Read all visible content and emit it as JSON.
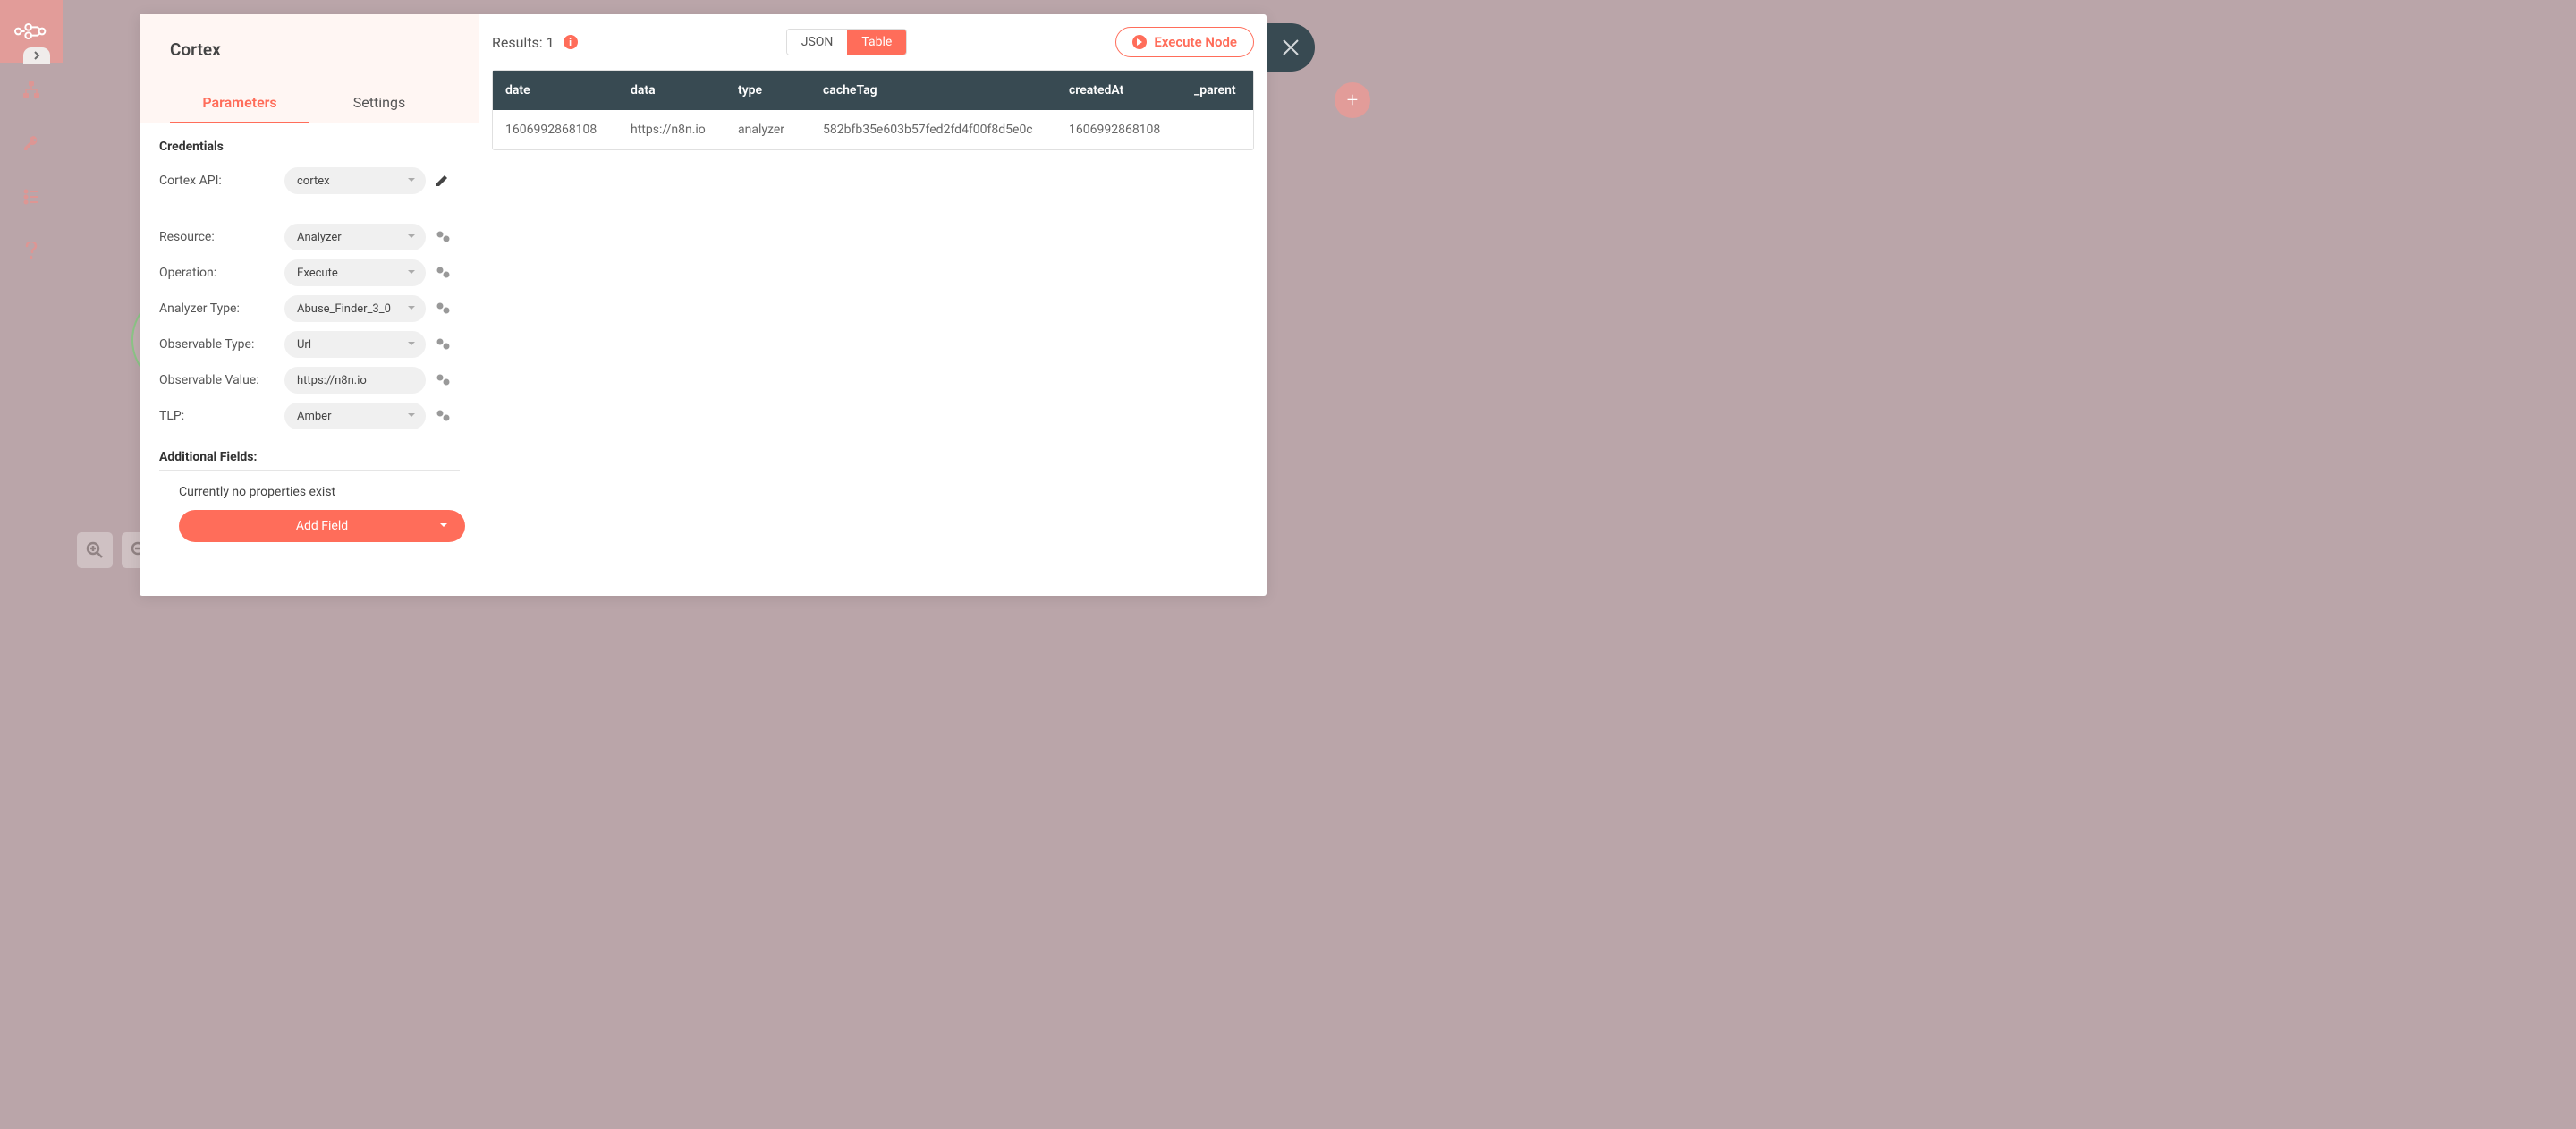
{
  "node": {
    "title": "Cortex",
    "tabs": {
      "parameters": "Parameters",
      "settings": "Settings"
    }
  },
  "credentials": {
    "section": "Credentials",
    "api_label": "Cortex API:",
    "api_value": "cortex"
  },
  "params": {
    "resource": {
      "label": "Resource:",
      "value": "Analyzer"
    },
    "operation": {
      "label": "Operation:",
      "value": "Execute"
    },
    "analyzer_type": {
      "label": "Analyzer Type:",
      "value": "Abuse_Finder_3_0"
    },
    "observable_type": {
      "label": "Observable Type:",
      "value": "Url"
    },
    "observable_value": {
      "label": "Observable Value:",
      "value": "https://n8n.io"
    },
    "tlp": {
      "label": "TLP:",
      "value": "Amber"
    }
  },
  "additional": {
    "title": "Additional Fields:",
    "empty": "Currently no properties exist",
    "add": "Add Field"
  },
  "results": {
    "label": "Results: 1",
    "view": {
      "json": "JSON",
      "table": "Table"
    },
    "execute": "Execute Node",
    "columns": [
      "date",
      "data",
      "type",
      "cacheTag",
      "createdAt",
      "_parent"
    ],
    "rows": [
      [
        "1606992868108",
        "https://n8n.io",
        "analyzer",
        "582bfb35e603b57fed2fd4f00f8d5e0c",
        "1606992868108",
        ""
      ]
    ]
  }
}
